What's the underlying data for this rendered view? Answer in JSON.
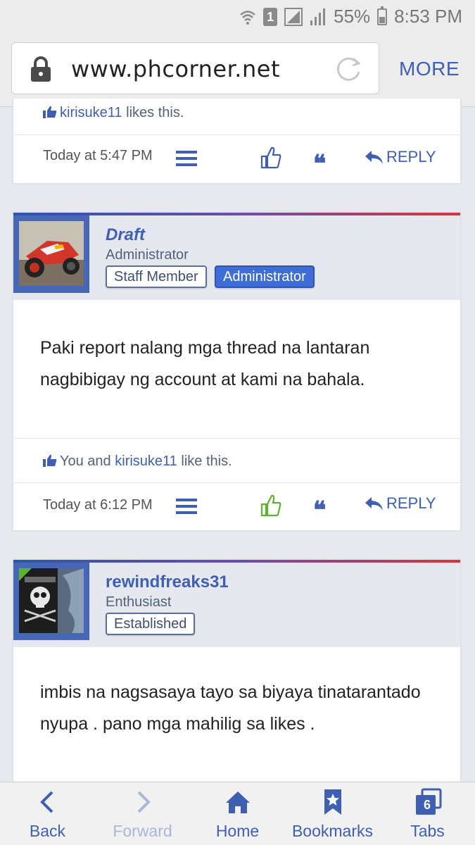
{
  "status_bar": {
    "battery": "55%",
    "time": "8:53 PM",
    "sim": "1"
  },
  "browser": {
    "url": "www.phcorner.net",
    "more_label": "MORE"
  },
  "post1": {
    "likes_text": "likes this.",
    "liker": "kirisuke11",
    "timestamp": "Today at 5:47 PM",
    "reply_label": "REPLY"
  },
  "post2": {
    "author_name": "Draft",
    "author_title": "Administrator",
    "badges": [
      "Staff Member",
      "Administrator"
    ],
    "message": "Paki report nalang mga thread na lantaran nagbibigay ng account at kami na bahala.",
    "likes_prefix": "You and",
    "liker": "kirisuke11",
    "likes_suffix": "like this.",
    "timestamp": "Today at 6:12 PM",
    "reply_label": "REPLY",
    "liked": true
  },
  "post3": {
    "author_name": "rewindfreaks31",
    "author_title": "Enthusiast",
    "badges": [
      "Established"
    ],
    "message": "imbis na nagsasaya tayo sa biyaya tinatarantado nyupa . pano mga mahilig sa likes ."
  },
  "bottom_nav": {
    "back": "Back",
    "forward": "Forward",
    "home": "Home",
    "bookmarks": "Bookmarks",
    "tabs": "Tabs",
    "tab_count": "6"
  },
  "colors": {
    "accent": "#3f5fb3",
    "like_active": "#5ab52c",
    "admin_badge": "#3e6dd8"
  }
}
